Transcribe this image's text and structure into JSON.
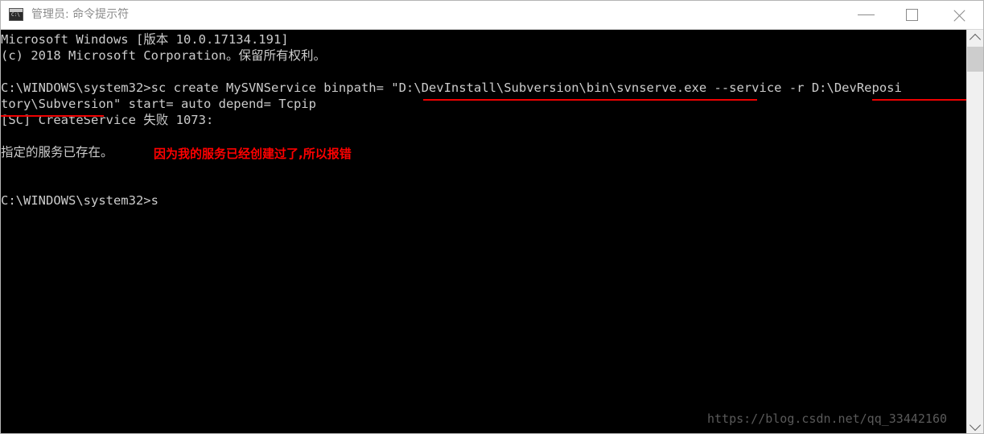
{
  "window": {
    "title": "管理员: 命令提示符",
    "icon": "console-icon",
    "controls": {
      "minimize": "—",
      "maximize": "□",
      "close": "✕"
    }
  },
  "console": {
    "background_color": "#000000",
    "text_color": "#cccccc",
    "lines": [
      "Microsoft Windows [版本 10.0.17134.191]",
      "(c) 2018 Microsoft Corporation。保留所有权利。",
      "C:\\WINDOWS\\system32>sc create MySVNService binpath= \"D:\\DevInstall\\Subversion\\bin\\svnserve.exe --service -r D:\\DevReposi",
      "tory\\Subversion\" start= auto depend= Tcpip",
      "[SC] CreateService 失败 1073:",
      "指定的服务已存在。",
      "C:\\WINDOWS\\system32>s"
    ],
    "annotation": {
      "text": "因为我的服务已经创建过了,所以报错",
      "color": "#ff0000"
    },
    "underline_color": "#ee0000",
    "watermark": "https://blog.csdn.net/qq_33442160"
  },
  "scrollbar": {
    "up_arrow": "▲",
    "down_arrow": "▼"
  }
}
